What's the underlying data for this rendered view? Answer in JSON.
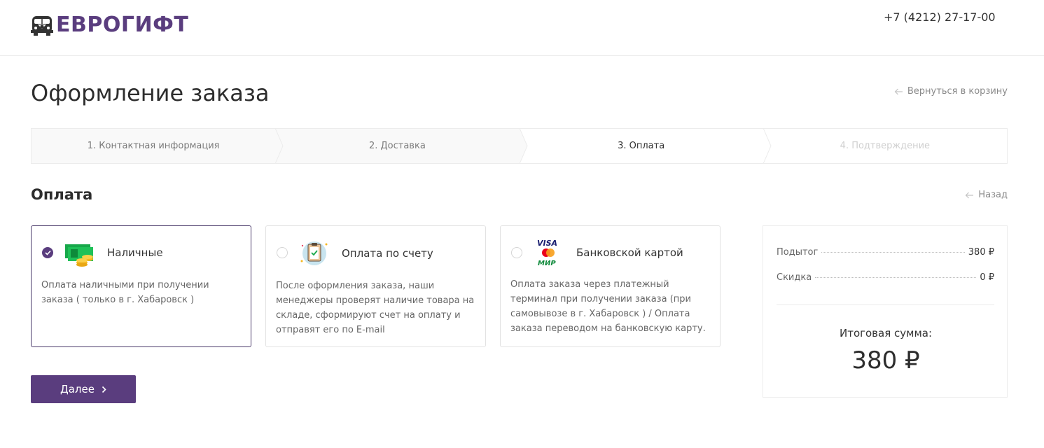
{
  "header": {
    "logo_text": "ЕВРОГИФТ",
    "phone": "+7 (4212) 27-17-00"
  },
  "page": {
    "title": "Оформление заказа",
    "back_to_cart": "Вернуться в корзину"
  },
  "steps": [
    {
      "label": "1. Контактная информация",
      "state": "done"
    },
    {
      "label": "2. Доставка",
      "state": "done"
    },
    {
      "label": "3. Оплата",
      "state": "active"
    },
    {
      "label": "4. Подтверждение",
      "state": "disabled"
    }
  ],
  "payment": {
    "title": "Оплата",
    "back": "Назад",
    "options": [
      {
        "name": "Наличные",
        "description": "Оплата наличными при получении заказа ( только в г. Хабаровск )",
        "selected": true,
        "icon": "cash-icon"
      },
      {
        "name": "Оплата по счету",
        "description": "После оформления заказа, наши менеджеры проверят наличие товара на складе, сформируют счет на оплату и отправят его по E-mail",
        "selected": false,
        "icon": "invoice-clipboard-icon"
      },
      {
        "name": "Банковской картой",
        "description": "Оплата заказа через платежный терминал при получении заказа (при самовывозе в г. Хабаровск ) / Оплата заказа переводом на банковскую карту.",
        "selected": false,
        "icon": "visa-mastercard-mir-icon"
      }
    ],
    "next_button": "Далее"
  },
  "summary": {
    "subtotal_label": "Подытог",
    "subtotal_value": "380 ₽",
    "discount_label": "Скидка",
    "discount_value": "0 ₽",
    "total_label": "Итоговая сумма:",
    "total_value": "380 ₽"
  },
  "colors": {
    "brand": "#5a3d7e",
    "border": "#e2e2e2",
    "mastercard_red": "#eb001b",
    "mastercard_orange": "#f79e1b",
    "visa_blue": "#1a1f71",
    "mir_green": "#0f8a3b"
  }
}
